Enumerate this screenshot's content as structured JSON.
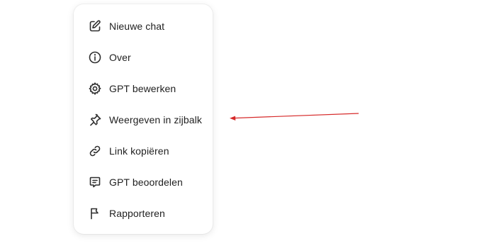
{
  "menu": {
    "items": [
      {
        "label": "Nieuwe chat",
        "icon": "pencil-square-icon"
      },
      {
        "label": "Over",
        "icon": "info-circle-icon"
      },
      {
        "label": "GPT bewerken",
        "icon": "gear-icon"
      },
      {
        "label": "Weergeven in zijbalk",
        "icon": "pin-icon"
      },
      {
        "label": "Link kopiëren",
        "icon": "link-icon"
      },
      {
        "label": "GPT beoordelen",
        "icon": "feedback-icon"
      },
      {
        "label": "Rapporteren",
        "icon": "flag-icon"
      }
    ]
  },
  "annotation": {
    "arrow_color": "#d62a2a",
    "points_to": "Weergeven in zijbalk"
  }
}
